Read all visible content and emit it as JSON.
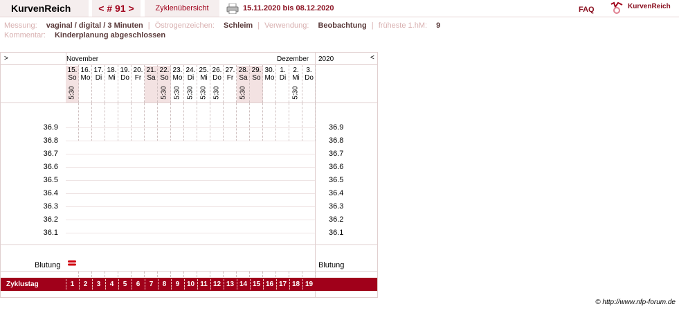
{
  "header": {
    "brand": "KurvenReich",
    "nav": "< # 91 >",
    "overview": "Zyklenübersicht",
    "date_range": "15.11.2020 bis 08.12.2020",
    "faq": "FAQ",
    "logo_text": "KurvenReich",
    "printer_icon": "printer-icon"
  },
  "info": {
    "messung_label": "Messung:",
    "messung_value": "vaginal / digital / 3 Minuten",
    "oestrogen_label": "Östrogenzeichen:",
    "oestrogen_value": "Schleim",
    "verwendung_label": "Verwendung:",
    "verwendung_value": "Beobachtung",
    "frueheste_label": "früheste 1.hM:",
    "frueheste_value": "9",
    "kommentar_label": "Kommentar:",
    "kommentar_value": "Kinderplanung abgeschlossen"
  },
  "chart": {
    "prev": ">",
    "next": "<",
    "month1": "November",
    "month2": "Dezember",
    "year": "2020",
    "days": [
      {
        "d": "15.",
        "w": "So",
        "t": "5:30",
        "we": true
      },
      {
        "d": "16.",
        "w": "Mo",
        "t": "",
        "we": false
      },
      {
        "d": "17.",
        "w": "Di",
        "t": "",
        "we": false
      },
      {
        "d": "18.",
        "w": "Mi",
        "t": "",
        "we": false
      },
      {
        "d": "19.",
        "w": "Do",
        "t": "",
        "we": false
      },
      {
        "d": "20.",
        "w": "Fr",
        "t": "",
        "we": false
      },
      {
        "d": "21.",
        "w": "Sa",
        "t": "",
        "we": true
      },
      {
        "d": "22.",
        "w": "So",
        "t": "5:30",
        "we": true
      },
      {
        "d": "23.",
        "w": "Mo",
        "t": "5:30",
        "we": false
      },
      {
        "d": "24.",
        "w": "Di",
        "t": "5:30",
        "we": false
      },
      {
        "d": "25.",
        "w": "Mi",
        "t": "5:30",
        "we": false
      },
      {
        "d": "26.",
        "w": "Do",
        "t": "5:30",
        "we": false
      },
      {
        "d": "27.",
        "w": "Fr",
        "t": "",
        "we": false
      },
      {
        "d": "28.",
        "w": "Sa",
        "t": "5:30",
        "we": true
      },
      {
        "d": "29.",
        "w": "So",
        "t": "",
        "we": true
      },
      {
        "d": "30.",
        "w": "Mo",
        "t": "",
        "we": false
      },
      {
        "d": "1.",
        "w": "Di",
        "t": "",
        "we": false
      },
      {
        "d": "2.",
        "w": "Mi",
        "t": "5:30",
        "we": false
      },
      {
        "d": "3.",
        "w": "Do",
        "t": "",
        "we": false
      }
    ],
    "temps": [
      "36.9",
      "36.8",
      "36.7",
      "36.6",
      "36.5",
      "36.4",
      "36.3",
      "36.2",
      "36.1"
    ],
    "blutung_label": "Blutung",
    "blutung_days": [
      1
    ],
    "zyklustag_label": "Zyklustag",
    "zyklustage": [
      "1",
      "2",
      "3",
      "4",
      "5",
      "6",
      "7",
      "8",
      "9",
      "10",
      "11",
      "12",
      "13",
      "14",
      "15",
      "16",
      "17",
      "18",
      "19"
    ],
    "accent_color": "#a0001a",
    "weekend_color": "#f3e2e2"
  },
  "footer": {
    "copyright": "© http://www.nfp-forum.de"
  }
}
